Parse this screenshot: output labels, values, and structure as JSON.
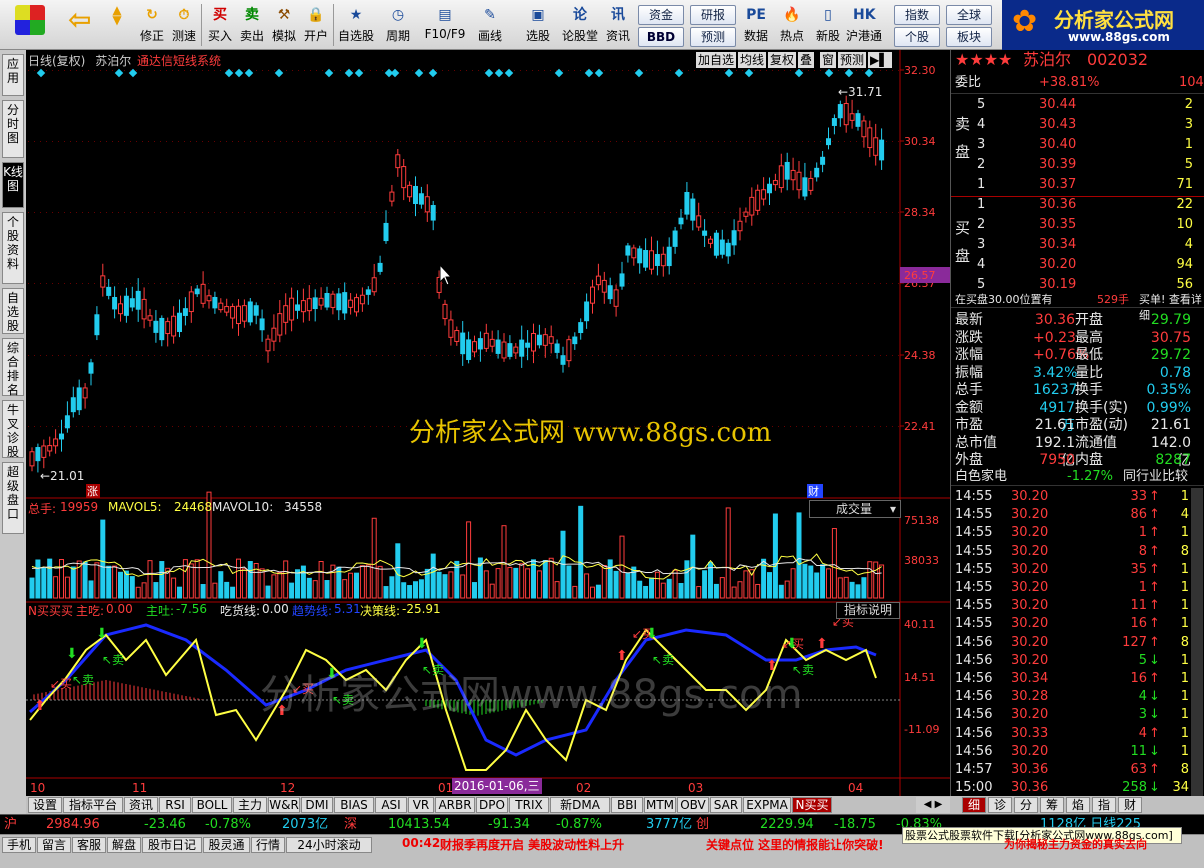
{
  "toolbar": {
    "left_buttons": [
      {
        "label": "修正",
        "icon": "refresh-icon"
      },
      {
        "label": "测速",
        "icon": "clock-icon"
      }
    ],
    "trade_buttons": [
      {
        "label": "买入",
        "icon": "buy-icon",
        "glyph": "买",
        "color": "#d00000"
      },
      {
        "label": "卖出",
        "icon": "sell-icon",
        "glyph": "卖",
        "color": "#008800"
      },
      {
        "label": "模拟",
        "icon": "hammer-icon",
        "glyph": "⚒",
        "color": "#8a4a00"
      },
      {
        "label": "开户",
        "icon": "lock-icon",
        "glyph": "🔒",
        "color": "#777"
      }
    ],
    "main_buttons": [
      {
        "label": "自选股",
        "icon": "star-icon",
        "glyph": "★"
      },
      {
        "label": "周期",
        "icon": "cycle-icon",
        "glyph": "◷"
      },
      {
        "label": "F10/F9",
        "icon": "f10-icon",
        "glyph": "▤"
      },
      {
        "label": "画线",
        "icon": "pen-icon",
        "glyph": "✎"
      },
      {
        "label": "选股",
        "icon": "screen-icon",
        "glyph": "▣"
      },
      {
        "label": "论股堂",
        "icon": "forum-icon",
        "glyph": "论"
      },
      {
        "label": "资讯",
        "icon": "news-icon",
        "glyph": "讯"
      }
    ],
    "small_buttons": [
      [
        "资金",
        "BBD"
      ],
      [
        "研报",
        "预测"
      ]
    ],
    "right_buttons": [
      {
        "label": "数据",
        "icon": "pe-icon",
        "glyph": "PE"
      },
      {
        "label": "热点",
        "icon": "fire-icon",
        "glyph": "🔥"
      },
      {
        "label": "新股",
        "icon": "newstock-icon",
        "glyph": "▯"
      },
      {
        "label": "沪港通",
        "icon": "hk-icon",
        "glyph": "HK"
      }
    ],
    "index_buttons": [
      [
        "指数",
        "个股"
      ],
      [
        "全球",
        "板块"
      ]
    ]
  },
  "logo": {
    "title": "分析家公式网",
    "url": "www.88gs.com"
  },
  "left_tabs": [
    "应用",
    "分时图",
    "K线图",
    "个股资料",
    "自选股",
    "综合排名",
    "牛叉诊股",
    "超级盘口"
  ],
  "chart": {
    "header": {
      "period": "日线(复权)",
      "stock": "苏泊尔",
      "system": "通达信短线系统"
    },
    "buttons": [
      "加自选",
      "均线",
      "复权",
      "叠",
      "窗",
      "预测"
    ],
    "price_axis": [
      "32.30",
      "30.34",
      "28.34",
      "26.57",
      "26.37",
      "24.38",
      "22.41"
    ],
    "current_price_tag": "26.57",
    "high_label": "31.71",
    "low_label": "21.01",
    "marker_zhang": "涨",
    "marker_cai": "财",
    "watermark": "分析家公式网 www.88gs.com",
    "watermark2": "分析家公式网www.88gs.com",
    "volume": {
      "label": "总手:",
      "value": "19959",
      "ma5_label": "MAVOL5:",
      "ma5": "24468",
      "ma10_label": "MAVOL10:",
      "ma10": "34558",
      "selector": "成交量",
      "axis": [
        "75138",
        "38033"
      ]
    },
    "indicator": {
      "name": "N买买买",
      "items": [
        [
          "主吃:",
          "0.00"
        ],
        [
          "主吐:",
          "-7.56"
        ],
        [
          "吃货线:",
          "0.00"
        ],
        [
          "趋势线:",
          "5.31"
        ],
        [
          "决策线:",
          "-25.91"
        ]
      ],
      "help": "指标说明",
      "axis": [
        "40.11",
        "14.51",
        "-11.09"
      ],
      "buy_label": "买",
      "sell_label": "卖"
    },
    "x_axis": [
      "10",
      "11",
      "12",
      "01",
      "02",
      "03",
      "04"
    ],
    "date_cursor": "2016-01-06,三"
  },
  "quote": {
    "title": "苏泊尔",
    "code": "002032",
    "weibi_label": "委比",
    "weibi": "+38.81%",
    "weicha": "104",
    "sell_label": [
      "卖",
      "盘"
    ],
    "buy_label": [
      "买",
      "盘"
    ],
    "asks": [
      [
        "5",
        "30.44",
        "2"
      ],
      [
        "4",
        "30.43",
        "3"
      ],
      [
        "3",
        "30.40",
        "1"
      ],
      [
        "2",
        "30.39",
        "5"
      ],
      [
        "1",
        "30.37",
        "71"
      ]
    ],
    "bids": [
      [
        "1",
        "30.36",
        "22"
      ],
      [
        "2",
        "30.35",
        "10"
      ],
      [
        "3",
        "30.34",
        "4"
      ],
      [
        "4",
        "30.20",
        "94"
      ],
      [
        "5",
        "30.19",
        "56"
      ]
    ],
    "notice": "在买盘30.00位置有",
    "notice_qty": "529手",
    "notice_link": "买单! 查看详细",
    "stats": [
      [
        "最新",
        "30.36",
        "开盘",
        "29.79"
      ],
      [
        "涨跌",
        "+0.23",
        "最高",
        "30.75"
      ],
      [
        "涨幅",
        "+0.76%",
        "最低",
        "29.72"
      ],
      [
        "振幅",
        "3.42%",
        "量比",
        "0.78"
      ],
      [
        "总手",
        "16237",
        "换手",
        "0.35%"
      ],
      [
        "金额",
        "4917万",
        "换手(实)",
        "0.99%"
      ],
      [
        "市盈",
        "21.61",
        "市盈(动)",
        "21.61"
      ],
      [
        "总市值",
        "192.1亿",
        "流通值",
        "142.0亿"
      ],
      [
        "外盘",
        "7950",
        "内盘",
        "8287"
      ]
    ],
    "industry": "白色家电",
    "industry_pct": "-1.27%",
    "industry_link": "同行业比较",
    "ticks": [
      [
        "14:55",
        "30.20",
        "33",
        "up"
      ],
      [
        "14:55",
        "30.20",
        "86",
        "up"
      ],
      [
        "14:55",
        "30.20",
        "1",
        "up"
      ],
      [
        "14:55",
        "30.20",
        "8",
        "up"
      ],
      [
        "14:55",
        "30.20",
        "35",
        "up"
      ],
      [
        "14:55",
        "30.20",
        "1",
        "up"
      ],
      [
        "14:55",
        "30.20",
        "11",
        "up"
      ],
      [
        "14:55",
        "30.20",
        "16",
        "up"
      ],
      [
        "14:56",
        "30.20",
        "127",
        "up"
      ],
      [
        "14:56",
        "30.20",
        "5",
        "down"
      ],
      [
        "14:56",
        "30.34",
        "16",
        "up"
      ],
      [
        "14:56",
        "30.28",
        "4",
        "down"
      ],
      [
        "14:56",
        "30.20",
        "3",
        "down"
      ],
      [
        "14:56",
        "30.33",
        "4",
        "up"
      ],
      [
        "14:56",
        "30.20",
        "11",
        "down"
      ],
      [
        "14:57",
        "30.36",
        "63",
        "up"
      ],
      [
        "15:00",
        "30.36",
        "258",
        "down"
      ]
    ],
    "tick_right": [
      "1",
      "4",
      "1",
      "8",
      "1",
      "1",
      "1",
      "1",
      "8",
      "1",
      "1",
      "1",
      "1",
      "1",
      "1",
      "8",
      "34"
    ],
    "detail_tabs": [
      "细",
      "诊",
      "分",
      "筹",
      "焰",
      "指",
      "财"
    ]
  },
  "bottom_tabs": [
    "设置",
    "指标平台",
    "资讯",
    "RSI",
    "BOLL",
    "主力",
    "W&R",
    "DMI",
    "BIAS",
    "ASI",
    "VR",
    "ARBR",
    "DPO",
    "TRIX",
    "新DMA",
    "BBI",
    "MTM",
    "OBV",
    "SAR",
    "EXPMA",
    "N买买买"
  ],
  "indexbar": {
    "sh_label": "沪",
    "sh": "2984.96",
    "sh_chg": "-23.46",
    "sh_pct": "-0.78%",
    "sh_amt": "2073亿",
    "sz_label": "深",
    "sz": "10413.54",
    "sz_chg": "-91.34",
    "sz_pct": "-0.87%",
    "sz_amt": "3777亿",
    "cy_label": "创",
    "cy": "2229.94",
    "cy_chg": "-18.75",
    "cy_pct": "-0.83%",
    "extra": "1128亿 日线225"
  },
  "statusbar": {
    "buttons": [
      "手机",
      "留言",
      "客服",
      "解盘",
      "股市日记",
      "股灵通",
      "行情",
      "24小时滚动"
    ],
    "time": "00:42",
    "news": "财报季再度开启 美股波动性料上升",
    "news2": "关键点位 这里的情报能让你突破!",
    "ad": "股票公式股票软件下载[分析家公式网www.88gs.com]",
    "ad2": "为你揭秘主力资金的真实去向"
  }
}
